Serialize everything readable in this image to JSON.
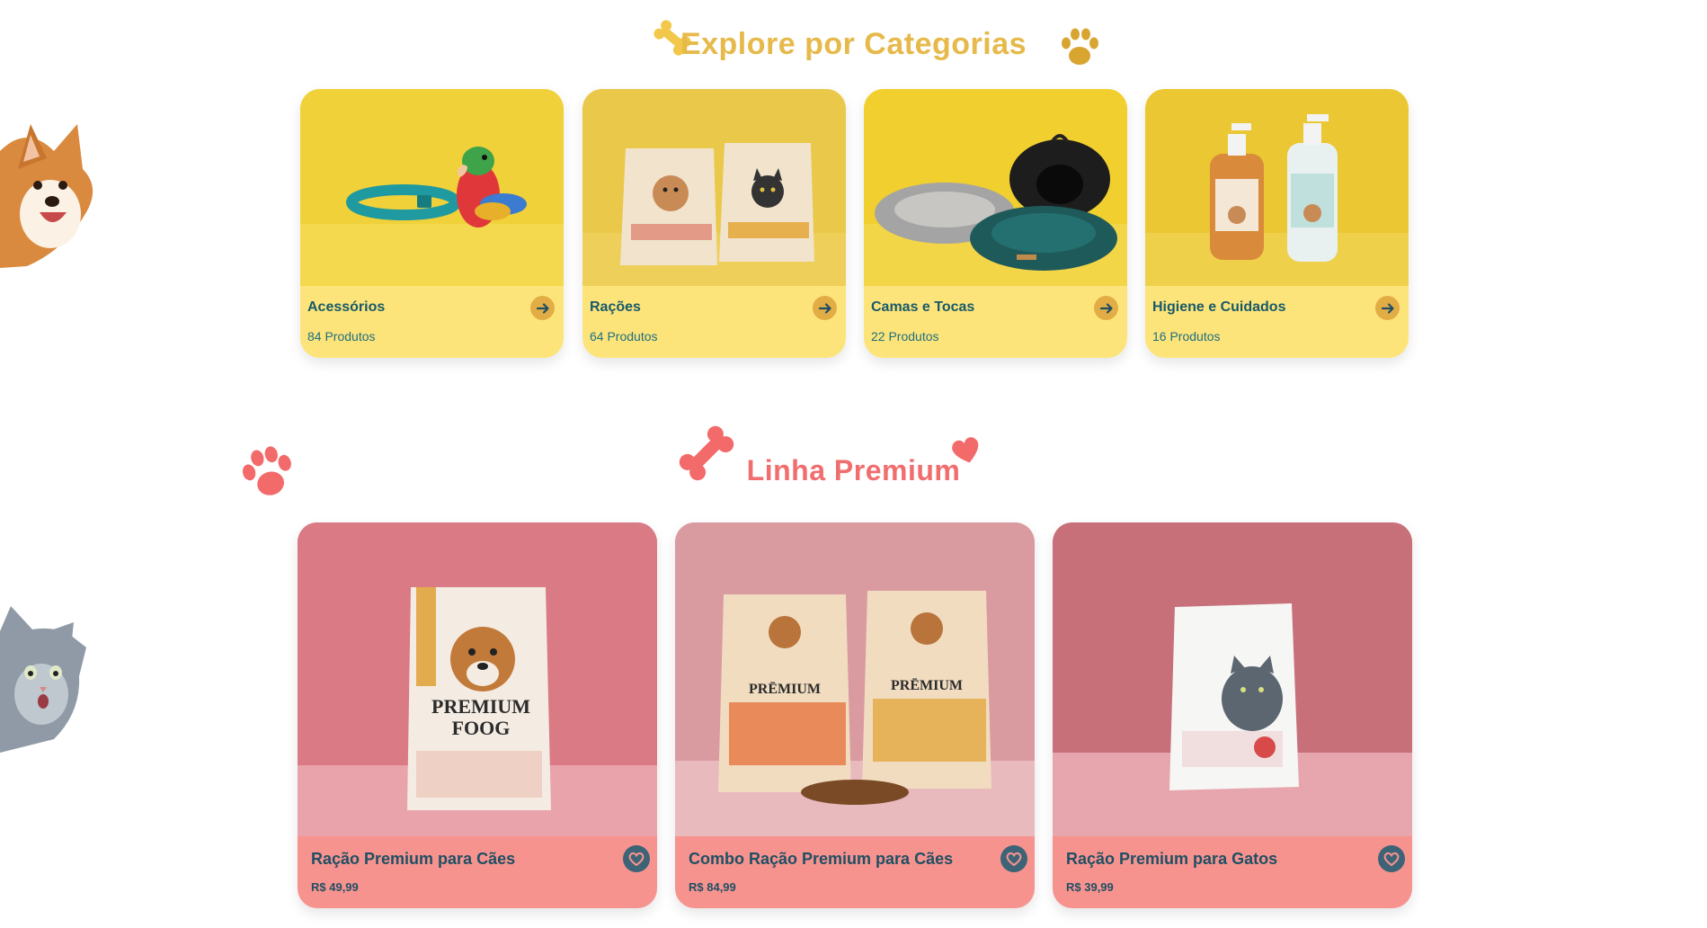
{
  "categories_section": {
    "title": "Explore por Categorias",
    "items": [
      {
        "label": "Acessórios",
        "count": "84 Produtos"
      },
      {
        "label": "Rações",
        "count": "64 Produtos"
      },
      {
        "label": "Camas e Tocas",
        "count": "22 Produtos"
      },
      {
        "label": "Higiene e Cuidados",
        "count": "16 Produtos"
      }
    ]
  },
  "premium_section": {
    "title": "Linha Premium",
    "items": [
      {
        "label": "Ração Premium para Cães",
        "price": "R$ 49,99"
      },
      {
        "label": "Combo Ração Premium para Cães",
        "price": "R$ 84,99"
      },
      {
        "label": "Ração Premium para Gatos",
        "price": "R$ 39,99"
      }
    ]
  },
  "colors": {
    "category_title": "#e6b94a",
    "category_card": "#fde47a",
    "premium_title": "#f06e6e",
    "premium_card": "#f7938f",
    "card_text": "#1f4f63"
  },
  "icons": [
    "bone-icon",
    "paw-icon",
    "heart-icon",
    "arrow-right-icon",
    "heart-outline-icon"
  ]
}
